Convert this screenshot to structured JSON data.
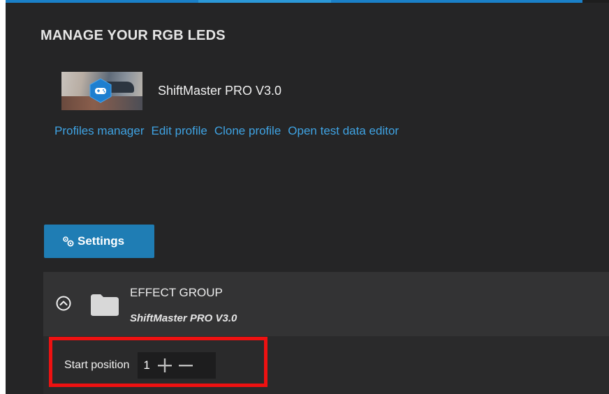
{
  "header": {
    "title": "MANAGE YOUR RGB LEDS"
  },
  "device": {
    "name": "ShiftMaster PRO V3.0",
    "thumbnail_icon": "gamepad-hex-icon"
  },
  "links": {
    "profiles_manager": "Profiles manager",
    "edit_profile": "Edit profile",
    "clone_profile": "Clone profile",
    "open_test_data_editor": "Open test data editor"
  },
  "settings_button": {
    "label": "Settings",
    "icon": "gears-icon"
  },
  "effect_group": {
    "title": "EFFECT GROUP",
    "subtitle": "ShiftMaster PRO V3.0",
    "collapse_icon": "chevron-up-circle-icon",
    "folder_icon": "folder-icon",
    "start_position": {
      "label": "Start position",
      "value": "1",
      "increment_icon": "plus-icon",
      "decrement_icon": "minus-icon"
    }
  },
  "colors": {
    "background": "#252526",
    "accent_blue": "#1f7db4",
    "link": "#3fa3e3",
    "highlight": "#ee1111"
  }
}
